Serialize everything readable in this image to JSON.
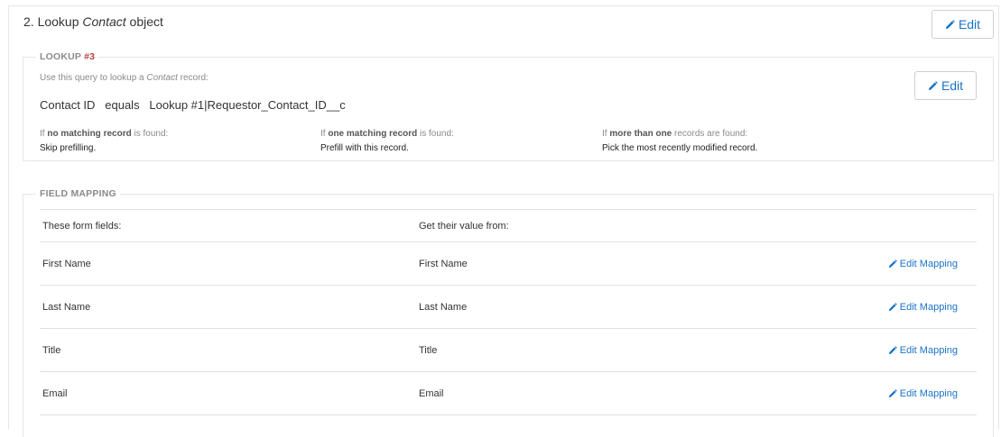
{
  "step": {
    "number": "2.",
    "prefix": "Lookup",
    "object": "Contact",
    "suffix": "object",
    "edit_label": "Edit"
  },
  "lookup": {
    "legend_label": "LOOKUP",
    "legend_number": "#3",
    "helper_prefix": "Use this query to lookup a",
    "helper_object": "Contact",
    "helper_suffix": "record:",
    "query_field": "Contact ID",
    "query_operator": "equals",
    "query_value": "Lookup #1|Requestor_Contact_ID__c",
    "edit_label": "Edit",
    "conditions": [
      {
        "prefix": "If",
        "bold": "no matching record",
        "suffix": "is found:",
        "value": "Skip prefilling."
      },
      {
        "prefix": "If",
        "bold": "one matching record",
        "suffix": "is found:",
        "value": "Prefill with this record."
      },
      {
        "prefix": "If",
        "bold": "more than one",
        "suffix": "records are found:",
        "value": "Pick the most recently modified record."
      }
    ]
  },
  "mapping": {
    "legend_label": "FIELD MAPPING",
    "header_fields": "These form fields:",
    "header_source": "Get their value from:",
    "edit_label": "Edit Mapping",
    "rows": [
      {
        "field": "First Name",
        "source": "First Name"
      },
      {
        "field": "Last Name",
        "source": "Last Name"
      },
      {
        "field": "Title",
        "source": "Title"
      },
      {
        "field": "Email",
        "source": "Email"
      }
    ]
  },
  "colors": {
    "link": "#1a73c8",
    "accent_number": "#b84242",
    "border": "#e6e6e6"
  },
  "icons": {
    "edit": "pencil-icon"
  }
}
